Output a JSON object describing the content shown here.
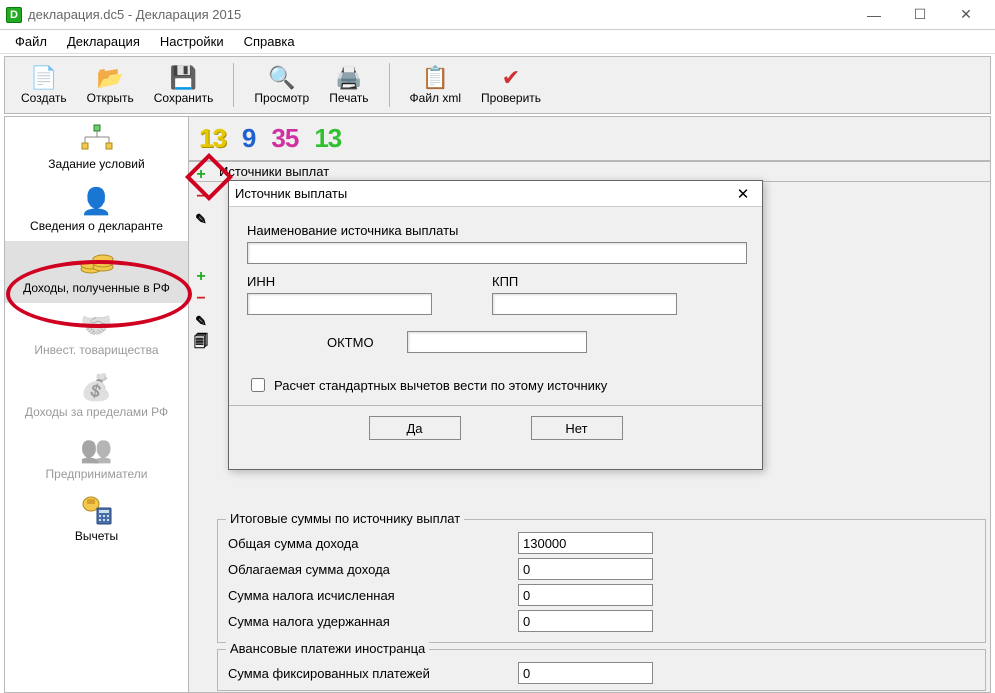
{
  "window": {
    "title": "декларация.dc5 - Декларация 2015",
    "app_icon_letter": "D"
  },
  "menu": {
    "file": "Файл",
    "declaration": "Декларация",
    "settings": "Настройки",
    "help": "Справка"
  },
  "toolbar": {
    "create": "Создать",
    "open": "Открыть",
    "save": "Сохранить",
    "preview": "Просмотр",
    "print": "Печать",
    "xml": "Файл xml",
    "check": "Проверить"
  },
  "sidebar": {
    "conditions": "Задание условий",
    "declarant": "Сведения о декларанте",
    "income_rf": "Доходы, полученные в РФ",
    "invest": "Инвест. товарищества",
    "income_abroad": "Доходы за пределами РФ",
    "entrepreneurs": "Предприниматели",
    "deductions": "Вычеты"
  },
  "tax_tabs": {
    "t13a": "13",
    "t9": "9",
    "t35": "35",
    "t13b": "13"
  },
  "sections": {
    "sources_header": "Источники выплат"
  },
  "totals": {
    "title": "Итоговые суммы по источнику выплат",
    "total_income_label": "Общая сумма дохода",
    "total_income_value": "130000",
    "taxable_income_label": "Облагаемая сумма дохода",
    "taxable_income_value": "0",
    "tax_calculated_label": "Сумма налога исчисленная",
    "tax_calculated_value": "0",
    "tax_withheld_label": "Сумма налога удержанная",
    "tax_withheld_value": "0"
  },
  "advance": {
    "title": "Авансовые платежи иностранца",
    "fixed_label": "Сумма фиксированных платежей",
    "fixed_value": "0"
  },
  "dialog": {
    "title": "Источник выплаты",
    "name_label": "Наименование источника выплаты",
    "name_value": "",
    "inn_label": "ИНН",
    "inn_value": "",
    "kpp_label": "КПП",
    "kpp_value": "",
    "oktmo_label": "ОКТМО",
    "oktmo_value": "",
    "checkbox_label": "Расчет стандартных вычетов вести по этому источнику",
    "yes": "Да",
    "no": "Нет"
  }
}
